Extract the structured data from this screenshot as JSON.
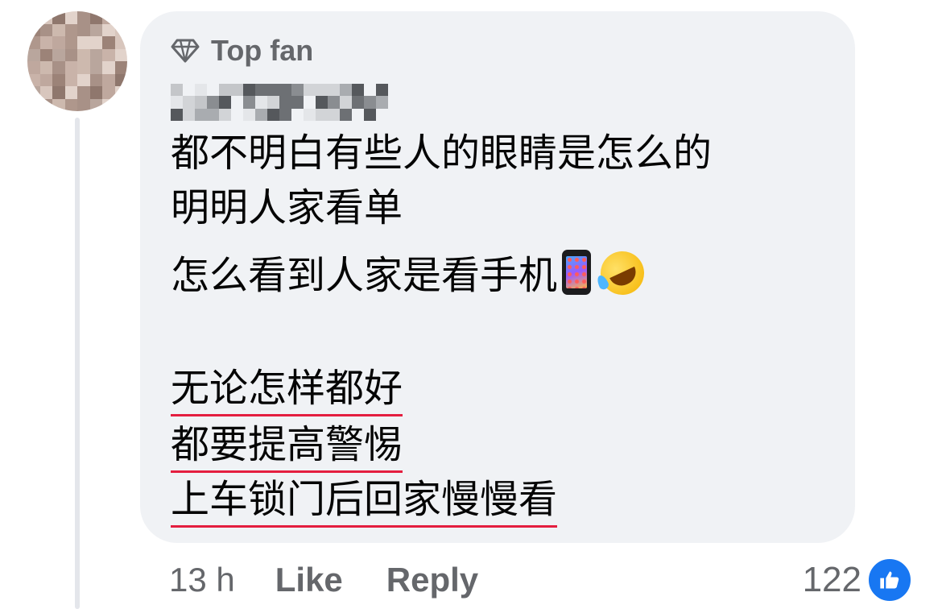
{
  "comment": {
    "badge_icon": "diamond-icon",
    "badge_label": "Top fan",
    "author_blurred": true,
    "lines": [
      "都不明白有些人的眼睛是怎么的",
      "明明人家看单",
      "怎么看到人家是看手机"
    ],
    "emojis": [
      "mobile-phone-emoji",
      "rolling-on-floor-laughing-emoji"
    ],
    "underlined_lines": [
      "无论怎样都好",
      "都要提高警惕",
      "上车锁门后回家慢慢看"
    ]
  },
  "footer": {
    "time": "13 h",
    "like_label": "Like",
    "reply_label": "Reply",
    "reaction_count": "122",
    "reaction_icon": "thumbs-up-icon"
  },
  "colors": {
    "bubble": "#f0f2f5",
    "text": "#050505",
    "secondary": "#65676b",
    "underline": "#e41e3f",
    "like_blue": "#1877f2"
  }
}
